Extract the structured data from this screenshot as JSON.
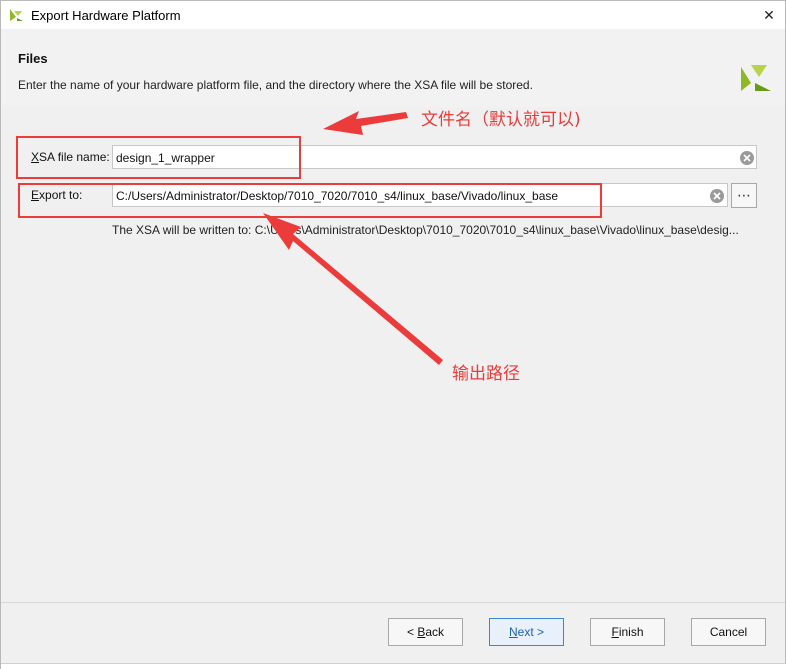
{
  "window": {
    "title": "Export Hardware Platform",
    "close_glyph": "✕"
  },
  "header": {
    "heading": "Files",
    "description": "Enter the name of your hardware platform file, and the directory where the XSA file will be stored."
  },
  "form": {
    "xsa_label_accel": "X",
    "xsa_label_rest": "SA file name:",
    "xsa_value": "design_1_wrapper",
    "export_label_accel": "E",
    "export_label_rest": "xport to:",
    "export_value": "C:/Users/Administrator/Desktop/7010_7020/7010_s4/linux_base/Vivado/linux_base",
    "browse_glyph": "⋯",
    "written_note": "The XSA will be written to: C:\\Users\\Administrator\\Desktop\\7010_7020\\7010_s4\\linux_base\\Vivado\\linux_base\\desig..."
  },
  "annotations": {
    "file_name_note": "文件名（默认就可以)",
    "output_path_note": "输出路径"
  },
  "buttons": {
    "back_prefix": "< ",
    "back_accel": "B",
    "back_rest": "ack",
    "next_accel": "N",
    "next_rest": "ext >",
    "finish_accel": "F",
    "finish_rest": "inish",
    "cancel": "Cancel"
  },
  "colors": {
    "annotation_red": "#ec3b3b",
    "logo_green": "#8dba24",
    "primary_border": "#3a87d8"
  },
  "icons": {
    "app": "vivado-logo-icon",
    "close": "close-icon",
    "clear": "clear-field-icon",
    "browse": "browse-ellipsis-icon"
  }
}
